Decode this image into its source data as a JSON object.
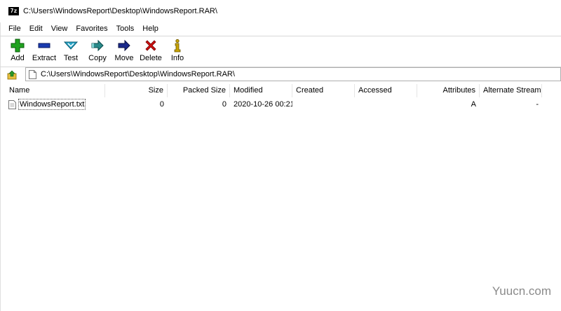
{
  "window": {
    "title": "C:\\Users\\WindowsReport\\Desktop\\WindowsReport.RAR\\",
    "icon_text": "7z"
  },
  "menu": [
    "File",
    "Edit",
    "View",
    "Favorites",
    "Tools",
    "Help"
  ],
  "toolbar": {
    "add": "Add",
    "extract": "Extract",
    "test": "Test",
    "copy": "Copy",
    "move": "Move",
    "delete": "Delete",
    "info": "Info"
  },
  "address": {
    "path": "C:\\Users\\WindowsReport\\Desktop\\WindowsReport.RAR\\"
  },
  "columns": {
    "name": "Name",
    "size": "Size",
    "packed_size": "Packed Size",
    "modified": "Modified",
    "created": "Created",
    "accessed": "Accessed",
    "attributes": "Attributes",
    "alternate_stream": "Alternate Stream"
  },
  "files": [
    {
      "name": "WindowsReport.txt",
      "size": "0",
      "packed_size": "0",
      "modified": "2020-10-26 00:21",
      "created": "",
      "accessed": "",
      "attributes": "A",
      "alternate_stream": "-"
    }
  ],
  "watermark": "Yuucn.com",
  "colors": {
    "add": "#1fa21f",
    "extract": "#1a3bb0",
    "test": "#2aa6c8",
    "copy": "#2a8a8a",
    "move": "#1b2a8c",
    "delete": "#d01010",
    "info": "#c8a400"
  }
}
